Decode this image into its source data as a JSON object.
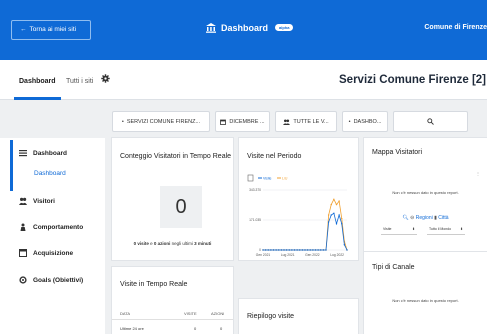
{
  "header": {
    "back_label": "Torna ai miei siti",
    "brand": "Dashboard",
    "badge": "alpha",
    "site": "Comune di Firenze"
  },
  "tabs": {
    "dashboard": "Dashboard",
    "all_sites": "Tutti i siti"
  },
  "page_title": "Servizi Comune Firenze [2]",
  "filters": [
    "SERVIZI COMUNE FIRENZ...",
    "DICEMBRE ...",
    "TUTTE LE V...",
    "DASHBO..."
  ],
  "sidebar": {
    "items": [
      "Dashboard",
      "Visitori",
      "Comportamento",
      "Acquisizione",
      "Goals (Obiettivi)"
    ],
    "sub_item": "Dashboard"
  },
  "cards": {
    "realtime_count": {
      "title": "Conteggio Visitatori in Tempo Reale",
      "value": "0",
      "visits_bold": "0 visite",
      "visits_mid": " e ",
      "visitors_bold": "0 azioni",
      "visits_tail": " negli ultimi ",
      "minutes": "3 minuti"
    },
    "period": {
      "title": "Visite nel Periodo",
      "legend_visits": "Visite",
      "legend_other": "L/U"
    },
    "map": {
      "title": "Mappa Visitatori",
      "no_data": "Non c'è nessun dato in questo report.",
      "regions": "Regioni",
      "cities": "Città",
      "select_left": "Visite",
      "select_right": "Tutto il Mondo"
    },
    "realtime_visits": {
      "title": "Visite in Tempo Reale",
      "col_date": "DATA",
      "col_visits": "VISITE",
      "col_actions": "AZIONI",
      "row_label": "Ultime 24 ore",
      "row_visits": "0",
      "row_actions": "0"
    },
    "summary": {
      "title": "Riepilogo visite"
    },
    "channels": {
      "title": "Tipi di Canale",
      "no_data": "Non c'è nessun dato in questo report."
    }
  },
  "chart_data": {
    "type": "line",
    "x": [
      "Gen 2021",
      "Lug 2021",
      "Gen 2022",
      "Lug 2022"
    ],
    "yticks": [
      "343.370",
      "171.035",
      "0"
    ],
    "ylim": [
      0,
      343370
    ],
    "series": [
      {
        "name": "Visite",
        "color": "#0f6ad6",
        "values": [
          0,
          0,
          0,
          0,
          0,
          0,
          0,
          0,
          0,
          0,
          0,
          0,
          0,
          0,
          0,
          0,
          0,
          0,
          0,
          0,
          0,
          0,
          0,
          0,
          0,
          160000,
          200000,
          210000,
          150000,
          200000,
          150000,
          30000,
          0
        ]
      },
      {
        "name": "L/U",
        "color": "#f0a030",
        "values": [
          0,
          0,
          0,
          0,
          0,
          0,
          0,
          0,
          0,
          0,
          0,
          0,
          0,
          0,
          0,
          0,
          0,
          0,
          0,
          0,
          0,
          0,
          0,
          0,
          0,
          200000,
          260000,
          290000,
          260000,
          280000,
          180000,
          50000,
          0
        ]
      }
    ]
  }
}
